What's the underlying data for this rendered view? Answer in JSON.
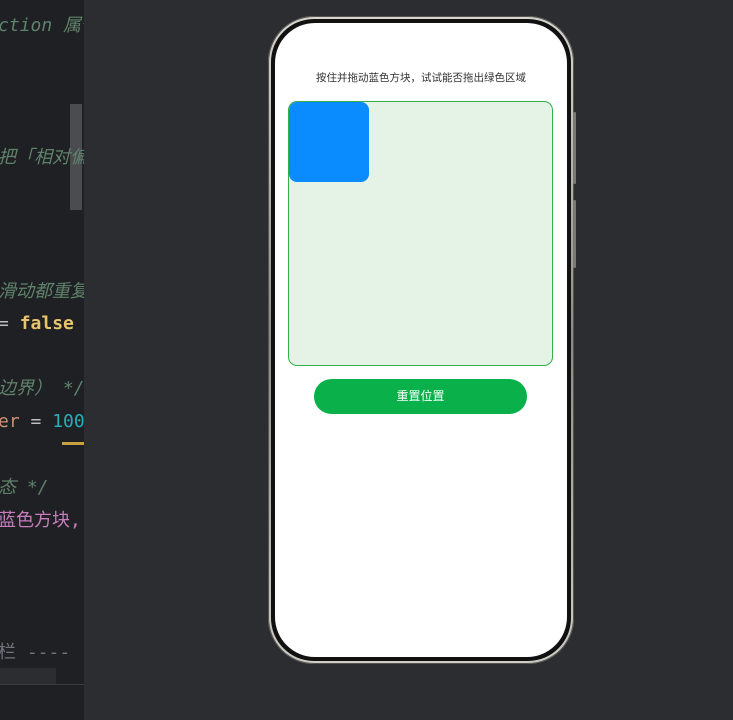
{
  "editor": {
    "lines": [
      {
        "text": "ction 属性",
        "kind": "comment"
      },
      {
        "text": "把「相对偏",
        "kind": "comment"
      },
      {
        "text": "滑动都重复",
        "kind": "comment"
      },
      {
        "text": "= ",
        "kind": "op",
        "extra": "false",
        "extra_kind": "kw"
      },
      {
        "text": "边界） */",
        "kind": "comment"
      },
      {
        "text": "er",
        "kind": "prop",
        "mid": " = ",
        "mid_kind": "op",
        "extra": "100",
        "extra_kind": "num"
      },
      {
        "text": "态 */",
        "kind": "comment"
      },
      {
        "text": "蓝色方块,",
        "kind": "purple"
      },
      {
        "text": "栏 ----",
        "kind": "gray"
      }
    ]
  },
  "app": {
    "instruction": "按住并拖动蓝色方块，试试能否拖出绿色区域",
    "reset_label": "重置位置"
  },
  "colors": {
    "accent_blue": "#0a8cff",
    "area_green_bg": "#e5f3e7",
    "area_green_border": "#33b04a",
    "button_green": "#0ab14a"
  }
}
